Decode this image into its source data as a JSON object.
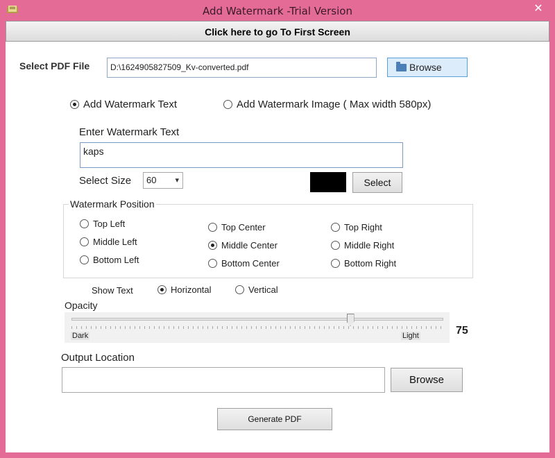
{
  "window": {
    "title": "Add Watermark  -Trial Version",
    "close_glyph": "✕"
  },
  "header": {
    "first_screen_label": "Click here to go To First Screen"
  },
  "pdf_file": {
    "label": "Select PDF File",
    "value": "D:\\1624905827509_Kv-converted.pdf",
    "browse_label": "Browse"
  },
  "mode": {
    "text_option": "Add Watermark Text",
    "image_option": "Add Watermark Image ( Max width 580px)",
    "selected": "text"
  },
  "watermark_text": {
    "label": "Enter Watermark Text",
    "value": "kaps"
  },
  "size": {
    "label": "Select Size",
    "value": "60",
    "chevron": "▾"
  },
  "color": {
    "swatch": "#000000",
    "select_label": "Select"
  },
  "position": {
    "legend": "Watermark Position",
    "options": [
      "Top Left",
      "Middle Left",
      "Bottom Left",
      "Top Center",
      "Middle Center",
      "Bottom Center",
      "Top Right",
      "Middle Right",
      "Bottom Right"
    ],
    "selected": "Middle Center"
  },
  "orientation": {
    "label": "Show Text",
    "horizontal": "Horizontal",
    "vertical": "Vertical",
    "selected": "horizontal"
  },
  "opacity": {
    "label": "Opacity",
    "dark_label": "Dark",
    "light_label": "Light",
    "value": "75"
  },
  "output": {
    "label": "Output Location",
    "value": "",
    "browse_label": "Browse"
  },
  "generate": {
    "label": "Generate PDF"
  },
  "colors": {
    "window_frame": "#e46b95",
    "browse_accent": "#dcecfb"
  }
}
